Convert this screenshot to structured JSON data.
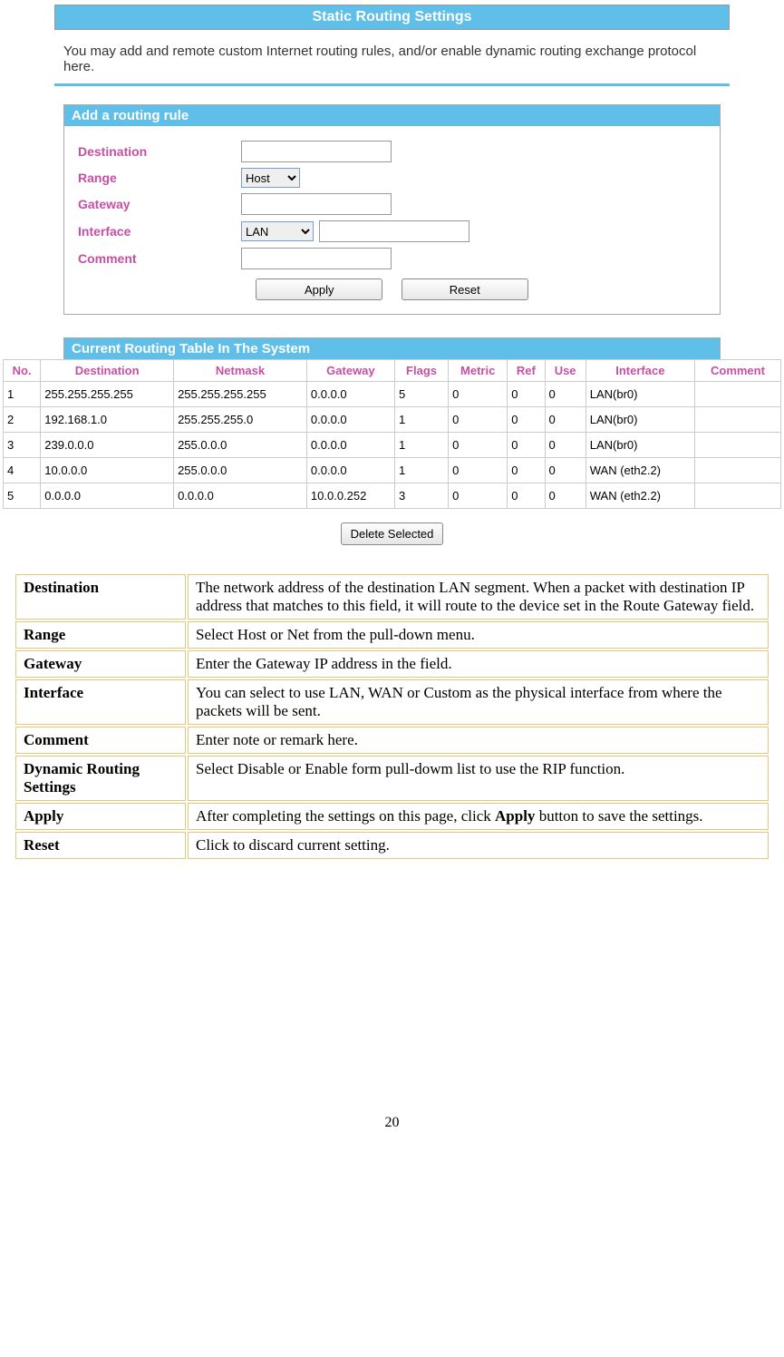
{
  "page_title": "Static Routing Settings",
  "intro": "You may add and remote custom Internet routing rules, and/or enable dynamic routing exchange protocol here.",
  "add_rule": {
    "header": "Add a routing rule",
    "destination_label": "Destination",
    "range_label": "Range",
    "range_value": "Host",
    "gateway_label": "Gateway",
    "interface_label": "Interface",
    "interface_value": "LAN",
    "comment_label": "Comment",
    "apply_btn": "Apply",
    "reset_btn": "Reset"
  },
  "routing_table": {
    "header": "Current Routing Table In The System",
    "columns": [
      "No.",
      "Destination",
      "Netmask",
      "Gateway",
      "Flags",
      "Metric",
      "Ref",
      "Use",
      "Interface",
      "Comment"
    ],
    "rows": [
      [
        "1",
        "255.255.255.255",
        "255.255.255.255",
        "0.0.0.0",
        "5",
        "0",
        "0",
        "0",
        "LAN(br0)",
        ""
      ],
      [
        "2",
        "192.168.1.0",
        "255.255.255.0",
        "0.0.0.0",
        "1",
        "0",
        "0",
        "0",
        "LAN(br0)",
        ""
      ],
      [
        "3",
        "239.0.0.0",
        "255.0.0.0",
        "0.0.0.0",
        "1",
        "0",
        "0",
        "0",
        "LAN(br0)",
        ""
      ],
      [
        "4",
        "10.0.0.0",
        "255.0.0.0",
        "0.0.0.0",
        "1",
        "0",
        "0",
        "0",
        "WAN (eth2.2)",
        ""
      ],
      [
        "5",
        "0.0.0.0",
        "0.0.0.0",
        "10.0.0.252",
        "3",
        "0",
        "0",
        "0",
        "WAN (eth2.2)",
        ""
      ]
    ],
    "delete_btn": "Delete Selected"
  },
  "descriptions": [
    {
      "term": "Destination",
      "def": "The network address of the destination LAN segment. When a packet with destination IP address that matches to this field, it will route to the device set in the Route Gateway field."
    },
    {
      "term": "Range",
      "def": "Select Host or Net from the pull-down menu."
    },
    {
      "term": "Gateway",
      "def": "Enter the Gateway IP address in the field."
    },
    {
      "term": "Interface",
      "def": "You can select to use LAN, WAN or Custom as the physical interface from where the packets will be sent."
    },
    {
      "term": "Comment",
      "def": "Enter note or remark here."
    },
    {
      "term": "Dynamic Routing Settings",
      "def": "Select Disable or Enable form pull-dowm list to use the RIP function."
    },
    {
      "term": "Apply",
      "def_pre": "After completing the settings on this page, click ",
      "def_bold": "Apply",
      "def_post": " button to save the settings."
    },
    {
      "term": "Reset",
      "def": "Click to discard current setting."
    }
  ],
  "page_number": "20"
}
